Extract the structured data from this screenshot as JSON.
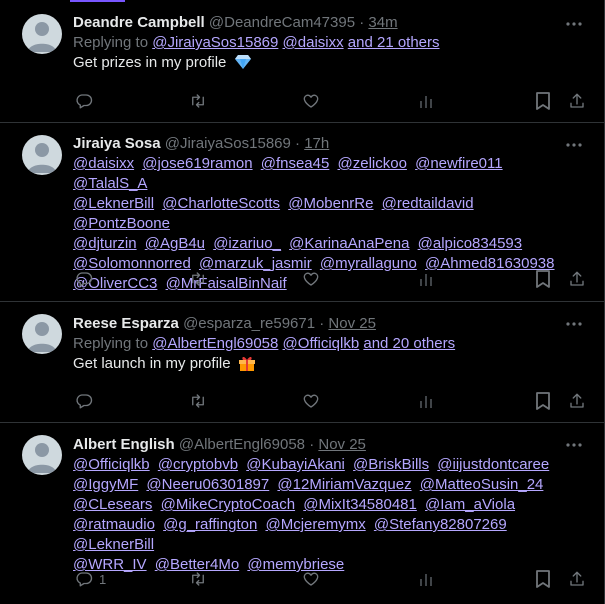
{
  "colors": {
    "background": "#000000",
    "text": "#e7e9ea",
    "muted": "#71767b",
    "link": "#b5a7ff",
    "border": "#2f3336"
  },
  "tweets": [
    {
      "name": "Deandre Campbell",
      "handle": "@DeandreCam47395",
      "dot": "·",
      "time": "34m",
      "replying_prefix": "Replying to",
      "replying_to": [
        "@JiraiyaSos15869",
        "@daisixx"
      ],
      "replying_others": "and 21 others",
      "text": "Get prizes in my profile",
      "emoji": "gem-icon",
      "reply_count": ""
    },
    {
      "name": "Jiraiya Sosa",
      "handle": "@JiraiyaSos15869",
      "dot": "·",
      "time": "17h",
      "mentions": [
        "@daisixx",
        "@jose619ramon",
        "@fnsea45",
        "@zelickoo",
        "@newfire011",
        "@TalalS_A",
        "@LeknerBill",
        "@CharlotteScotts",
        "@MobenrRe",
        "@redtaildavid",
        "@PontzBoone",
        "@djturzin",
        "@AgB4u",
        "@izariuo_",
        "@KarinaAnaPena",
        "@alpico834593",
        "@Solomonnorred",
        "@marzuk_jasmir",
        "@myrallaguno",
        "@Ahmed81630938",
        "@OliverCC3",
        "@MrFaisalBinNaif"
      ],
      "reply_count": ""
    },
    {
      "name": "Reese Esparza",
      "handle": "@esparza_re59671",
      "dot": "·",
      "time": "Nov 25",
      "replying_prefix": "Replying to",
      "replying_to": [
        "@AlbertEngl69058",
        "@Officiqlkb"
      ],
      "replying_others": "and 20 others",
      "text": "Get launch in my profile",
      "emoji": "gift-icon",
      "reply_count": ""
    },
    {
      "name": "Albert English",
      "handle": "@AlbertEngl69058",
      "dot": "·",
      "time": "Nov 25",
      "mentions": [
        "@Officiqlkb",
        "@cryptobvb",
        "@KubayiAkani",
        "@BriskBills",
        "@iijustdontcaree",
        "@IggyMF",
        "@Neeru06301897",
        "@12MiriamVazquez",
        "@MatteoSusin_24",
        "@CLesears",
        "@MikeCryptoCoach",
        "@MixIt34580481",
        "@Iam_aViola",
        "@ratmaudio",
        "@g_raffington",
        "@Mcjeremymx",
        "@Stefany82807269",
        "@LeknerBill",
        "@WRR_IV",
        "@Better4Mo",
        "@memybriese"
      ],
      "reply_count": "1"
    }
  ],
  "icons": {
    "more": "more-dots-icon",
    "reply": "reply-icon",
    "retweet": "retweet-icon",
    "like": "heart-icon",
    "views": "views-icon",
    "bookmark": "bookmark-icon",
    "share": "share-icon"
  }
}
